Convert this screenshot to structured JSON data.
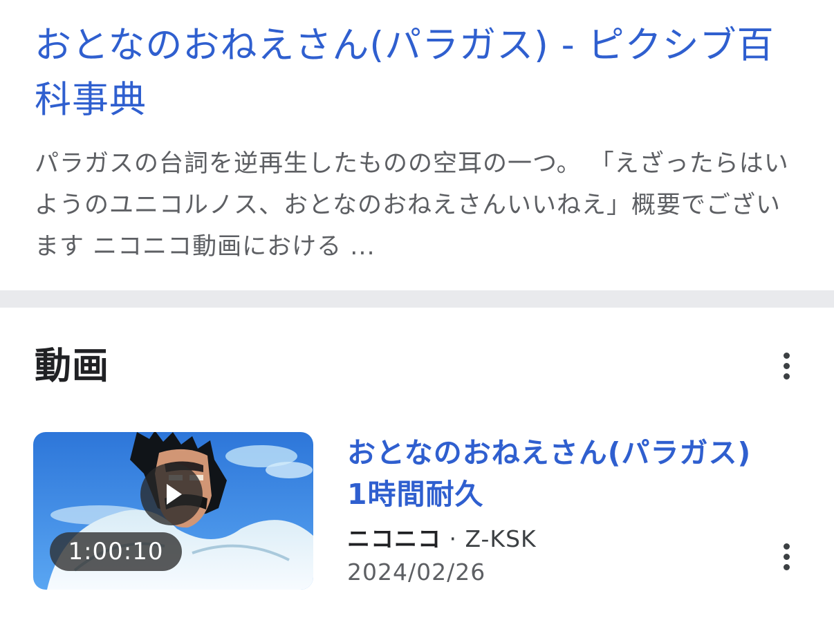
{
  "result": {
    "title": "おとなのおねえさん(パラガス) - ピクシブ百科事典",
    "snippet": "パラガスの台詞を逆再生したものの空耳の一つ。 「えざったらはいようのユニコルノス、おとなのおねえさんいいねえ」概要でございます ニコニコ動画における ..."
  },
  "videos": {
    "heading": "動画",
    "more_icon": "more-vert-icon",
    "items": [
      {
        "title": "おとなのおねえさん(パラガス) 1時間耐久",
        "source": "ニコニコ",
        "separator": "·",
        "author": "Z-KSK",
        "date": "2024/02/26",
        "duration": "1:00:10",
        "play_icon": "play-icon",
        "more_icon": "more-vert-icon"
      }
    ]
  },
  "colors": {
    "link": "#2f5fcf",
    "snippet": "#5d5f63",
    "heading": "#202124",
    "divider": "#e9eaed"
  }
}
